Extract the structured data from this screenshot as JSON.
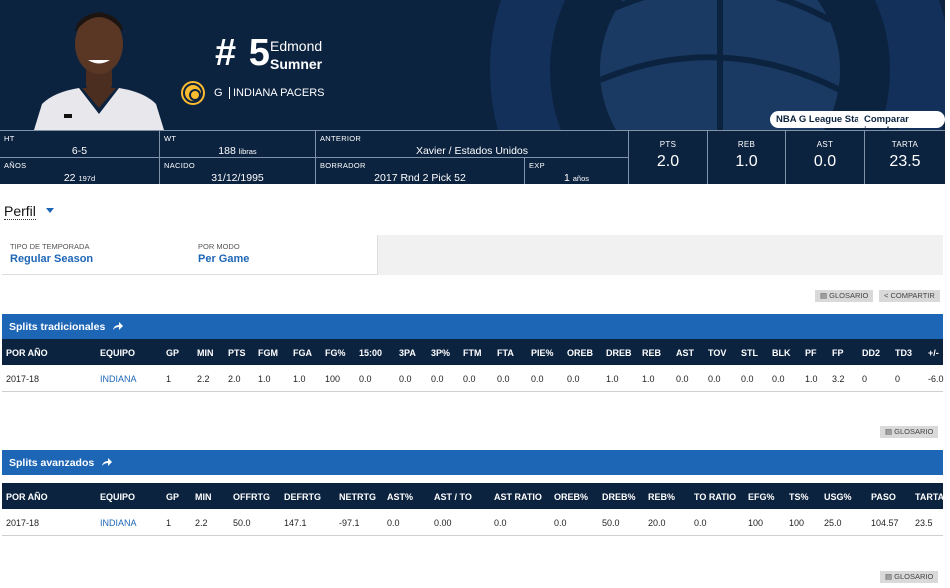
{
  "player": {
    "number": "# 5",
    "first_name": "Edmond",
    "last_name": "Sumner",
    "position": "G",
    "team": "INDIANA PACERS"
  },
  "header_buttons": {
    "g_league": "NBA G League Stats",
    "compare": "Comparar jugador"
  },
  "bio": {
    "ht": {
      "label": "HT",
      "value": "6-5"
    },
    "wt": {
      "label": "WT",
      "value": "188",
      "unit": "libras"
    },
    "prior": {
      "label": "ANTERIOR",
      "value": "Xavier / Estados Unidos"
    },
    "age": {
      "label": "AÑOS",
      "value": "22",
      "unit": "197d"
    },
    "born": {
      "label": "NACIDO",
      "value": "31/12/1995"
    },
    "draft": {
      "label": "BORRADOR",
      "value": "2017 Rnd 2 Pick 52"
    },
    "exp": {
      "label": "EXP",
      "value": "1",
      "unit": "años"
    }
  },
  "stats": [
    {
      "label": "PTS",
      "value": "2.0"
    },
    {
      "label": "REB",
      "value": "1.0"
    },
    {
      "label": "AST",
      "value": "0.0"
    },
    {
      "label": "TARTA",
      "value": "23.5"
    }
  ],
  "profile_label": "Perfil",
  "filters": {
    "season_type_label": "TIPO DE TEMPORADA",
    "season_type_value": "Regular Season",
    "mode_label": "POR MODO",
    "mode_value": "Per Game"
  },
  "buttons": {
    "glossary": "GLOSARIO",
    "share": "COMPARTIR"
  },
  "traditional": {
    "title": "Splits tradicionales",
    "headers": [
      "POR AÑO",
      "EQUIPO",
      "GP",
      "MIN",
      "PTS",
      "FGM",
      "FGA",
      "FG%",
      "15:00",
      "3PA",
      "3P%",
      "FTM",
      "FTA",
      "PIE%",
      "OREB",
      "DREB",
      "REB",
      "AST",
      "TOV",
      "STL",
      "BLK",
      "PF",
      "FP",
      "DD2",
      "TD3",
      "+/-"
    ],
    "row": [
      "2017-18",
      "INDIANA",
      "1",
      "2.2",
      "2.0",
      "1.0",
      "1.0",
      "100",
      "0.0",
      "0.0",
      "0.0",
      "0.0",
      "0.0",
      "0.0",
      "0.0",
      "1.0",
      "1.0",
      "0.0",
      "0.0",
      "0.0",
      "0.0",
      "1.0",
      "3.2",
      "0",
      "0",
      "-6.0"
    ]
  },
  "advanced": {
    "title": "Splits avanzados",
    "headers": [
      "POR AÑO",
      "EQUIPO",
      "GP",
      "MIN",
      "OFFRTG",
      "DEFRTG",
      "NETRTG",
      "AST%",
      "AST / TO",
      "AST RATIO",
      "OREB%",
      "DREB%",
      "REB%",
      "TO RATIO",
      "EFG%",
      "TS%",
      "USG%",
      "PASO",
      "TARTA"
    ],
    "row": [
      "2017-18",
      "INDIANA",
      "1",
      "2.2",
      "50.0",
      "147.1",
      "-97.1",
      "0.0",
      "0.00",
      "0.0",
      "0.0",
      "50.0",
      "20.0",
      "0.0",
      "100",
      "100",
      "25.0",
      "104.57",
      "23.5"
    ]
  }
}
